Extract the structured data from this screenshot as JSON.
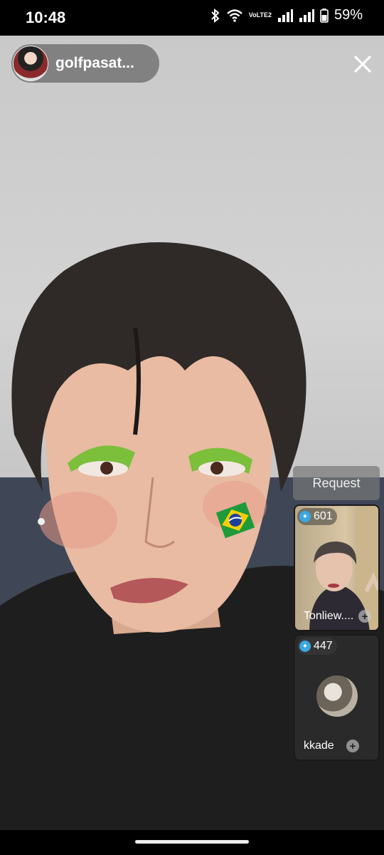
{
  "status_bar": {
    "time": "10:48",
    "volte_label": "VoLTE2",
    "battery": "59%"
  },
  "host": {
    "name": "golfpasat..."
  },
  "request_label": "Request",
  "guests": [
    {
      "count": "601",
      "name": "Tonliew...."
    },
    {
      "count": "447",
      "name": "kkade"
    }
  ],
  "colors": {
    "badge_icon": "#3aa8e0",
    "flag_green": "#1f9a3a",
    "flag_yellow": "#f5d000",
    "flag_blue": "#1d3f9e"
  }
}
